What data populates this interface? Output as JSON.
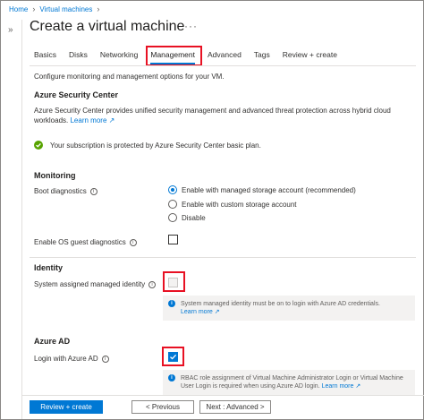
{
  "breadcrumb": {
    "home": "Home",
    "vms": "Virtual machines"
  },
  "page": {
    "title": "Create a virtual machine",
    "more": "···"
  },
  "tabs": [
    "Basics",
    "Disks",
    "Networking",
    "Management",
    "Advanced",
    "Tags",
    "Review + create"
  ],
  "active_tab": "Management",
  "intro": "Configure monitoring and management options for your VM.",
  "security_center": {
    "heading": "Azure Security Center",
    "description": "Azure Security Center provides unified security management and advanced threat protection across hybrid cloud workloads.",
    "learn_more": "Learn more",
    "status": "Your subscription is protected by Azure Security Center basic plan."
  },
  "monitoring": {
    "heading": "Monitoring",
    "boot_label": "Boot diagnostics",
    "boot_options": [
      "Enable with managed storage account (recommended)",
      "Enable with custom storage account",
      "Disable"
    ],
    "boot_selected": 0,
    "os_guest_label": "Enable OS guest diagnostics",
    "os_guest_checked": false
  },
  "identity": {
    "heading": "Identity",
    "managed_identity_label": "System assigned managed identity",
    "managed_identity_checked": false,
    "info": "System managed identity must be on to login with Azure AD credentials.",
    "learn_more": "Learn more"
  },
  "azure_ad": {
    "heading": "Azure AD",
    "login_label": "Login with Azure AD",
    "login_checked": true,
    "info": "RBAC role assignment of Virtual Machine Administrator Login or Virtual Machine User Login is required when using Azure AD login.",
    "learn_more": "Learn more"
  },
  "footer": {
    "review_create": "Review + create",
    "previous": "< Previous",
    "next": "Next : Advanced >"
  },
  "colors": {
    "accent": "#0078d4",
    "highlight": "#e81123",
    "success": "#57a300"
  },
  "icons": {
    "info": "info-icon",
    "success": "check-circle-icon",
    "external": "external-link-icon",
    "chevron": "chevron-right-icon"
  }
}
